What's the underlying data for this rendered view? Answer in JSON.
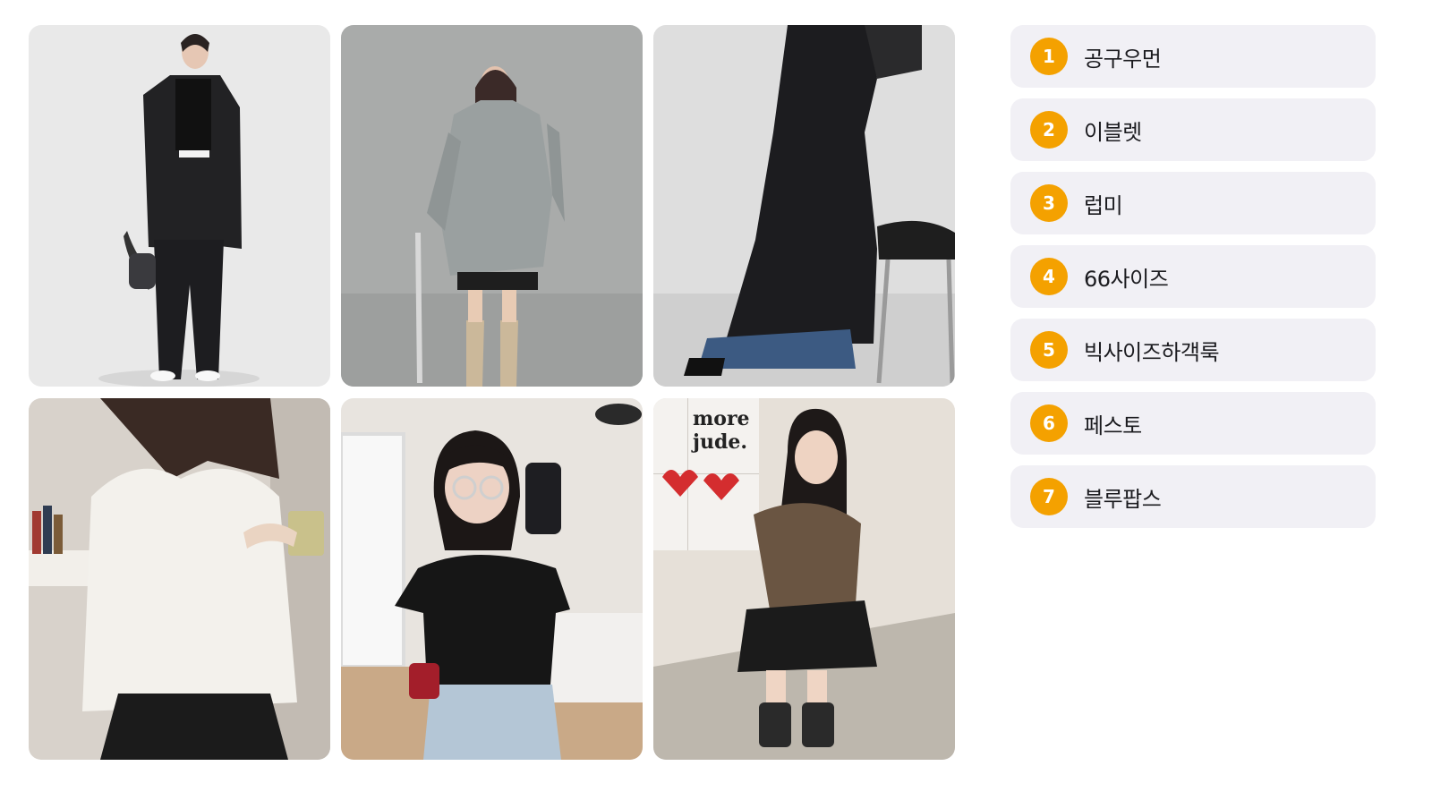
{
  "gallery": {
    "photos": [
      {
        "alt": "black blazer and wide trousers outfit",
        "icon": "photo-icon"
      },
      {
        "alt": "grey windbreaker jacket with umbrella",
        "icon": "photo-icon"
      },
      {
        "alt": "black long wrap dress with jeans",
        "icon": "photo-icon"
      },
      {
        "alt": "white ruffled shirt",
        "icon": "photo-icon"
      },
      {
        "alt": "black polka dot blouse mirror selfie",
        "icon": "photo-icon"
      },
      {
        "alt": "brown blouse and black ruffle skirt",
        "icon": "photo-icon"
      }
    ],
    "poster_text": [
      "more",
      "jude."
    ]
  },
  "ranking": {
    "accent_color": "#f4a100",
    "items": [
      {
        "rank": "1",
        "label": "공구우먼"
      },
      {
        "rank": "2",
        "label": "이블렛"
      },
      {
        "rank": "3",
        "label": "럽미"
      },
      {
        "rank": "4",
        "label": "66사이즈"
      },
      {
        "rank": "5",
        "label": "빅사이즈하객룩"
      },
      {
        "rank": "6",
        "label": "페스토"
      },
      {
        "rank": "7",
        "label": "블루팝스"
      }
    ]
  }
}
